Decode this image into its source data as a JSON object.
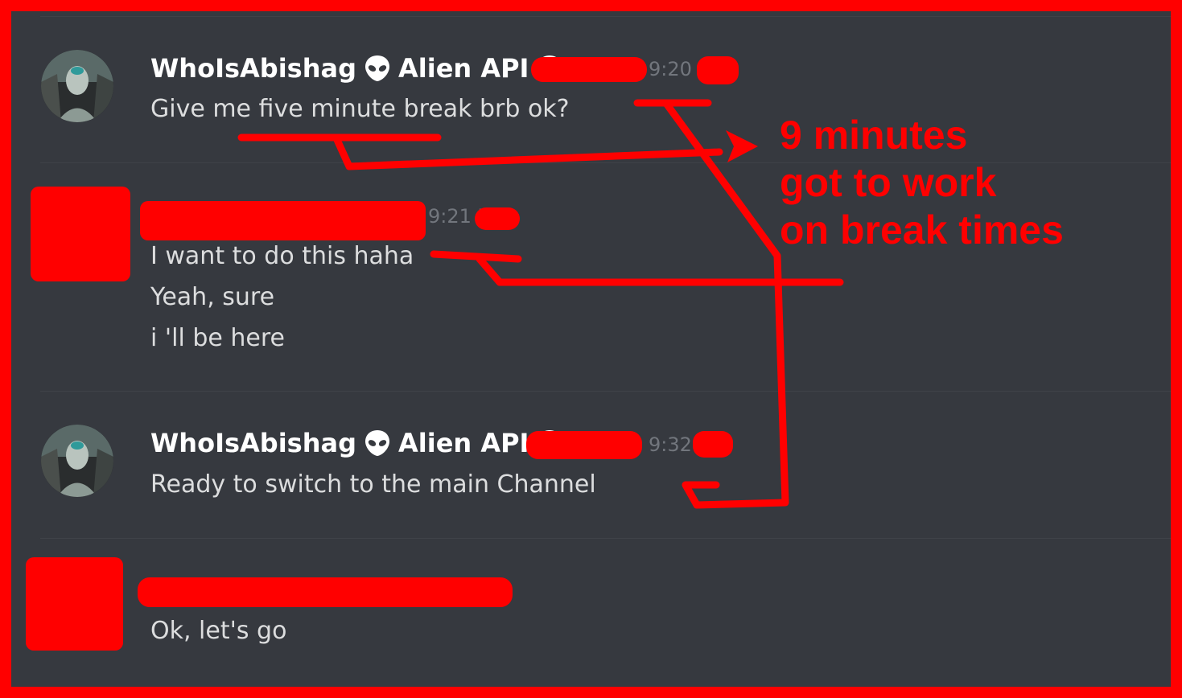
{
  "messages": [
    {
      "author": "WhoIsAbishag",
      "role_tag": "Alien API",
      "time": "9:20",
      "lines": [
        "Give me five minute break brb ok?"
      ]
    },
    {
      "author": "",
      "role_tag": "",
      "time": "9:21 P",
      "lines": [
        "I want to do this haha",
        "Yeah, sure",
        "i 'll be here"
      ]
    },
    {
      "author": "WhoIsAbishag",
      "role_tag": "Alien API",
      "time": "9:32",
      "lines": [
        "Ready to switch to the main Channel"
      ]
    },
    {
      "author": "",
      "role_tag": "",
      "time": "",
      "lines": [
        "Ok, let's go"
      ]
    }
  ],
  "annotation": {
    "lines": [
      "9 minutes",
      "got to work",
      "on break times"
    ]
  },
  "icons": {
    "author_badge": "alien-icon",
    "role_badge": "alien-icon"
  },
  "colors": {
    "background": "#36393f",
    "border_and_annotation": "#ff0000",
    "username": "#ffffff",
    "message_text": "#dcddde",
    "timestamp": "#72767d"
  }
}
